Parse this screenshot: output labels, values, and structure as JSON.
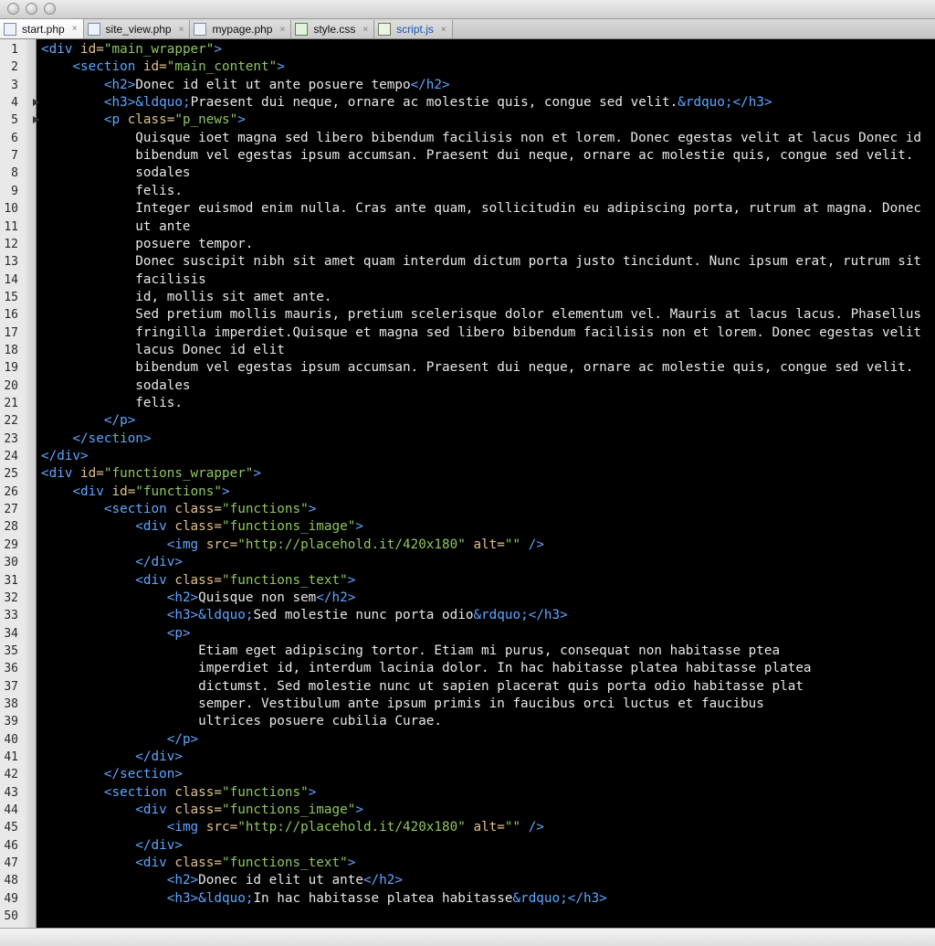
{
  "tabs": [
    {
      "label": "start.php",
      "type": "php",
      "active": true,
      "close": "×"
    },
    {
      "label": "site_view.php",
      "type": "php",
      "active": false,
      "close": "×"
    },
    {
      "label": "mypage.php",
      "type": "php",
      "active": false,
      "close": "×"
    },
    {
      "label": "style.css",
      "type": "css",
      "active": false,
      "close": "×"
    },
    {
      "label": "script.js",
      "type": "js",
      "active": false,
      "close": "×"
    }
  ],
  "colors": {
    "background": "#000000",
    "tag": "#5ea6ff",
    "attribute": "#e2c08d",
    "string": "#8ec760",
    "text": "#e8e8e8",
    "entity": "#5ea6ff"
  },
  "code": [
    {
      "n": "1",
      "fold": false,
      "segs": [
        [
          "t",
          "<div "
        ],
        [
          "a",
          "id="
        ],
        [
          "s",
          "\"main_wrapper\""
        ],
        [
          "t",
          ">"
        ]
      ]
    },
    {
      "n": "2",
      "fold": false,
      "segs": [
        [
          "x",
          "    "
        ],
        [
          "t",
          "<section "
        ],
        [
          "a",
          "id="
        ],
        [
          "s",
          "\"main_content\""
        ],
        [
          "t",
          ">"
        ]
      ]
    },
    {
      "n": "3",
      "fold": false,
      "segs": [
        [
          "x",
          "        "
        ],
        [
          "t",
          "<h2>"
        ],
        [
          "x",
          "Donec id elit ut ante posuere tempo"
        ],
        [
          "t",
          "</h2>"
        ]
      ]
    },
    {
      "n": "4",
      "fold": true,
      "segs": [
        [
          "x",
          "        "
        ],
        [
          "t",
          "<h3>"
        ],
        [
          "e",
          "&ldquo;"
        ],
        [
          "x",
          "Praesent dui neque, ornare ac molestie quis, congue sed velit."
        ],
        [
          "e",
          "&rdquo;"
        ],
        [
          "t",
          "</h3>"
        ]
      ]
    },
    {
      "n": "5",
      "fold": true,
      "segs": [
        [
          "x",
          "        "
        ],
        [
          "t",
          "<p "
        ],
        [
          "a",
          "class="
        ],
        [
          "s",
          "\"p_news\""
        ],
        [
          "t",
          ">"
        ]
      ]
    },
    {
      "n": "6",
      "fold": false,
      "segs": [
        [
          "x",
          "            Quisque ioet magna sed libero bibendum facilisis non et lorem. Donec egestas velit at lacus Donec id"
        ]
      ]
    },
    {
      "n": "7",
      "fold": false,
      "segs": [
        [
          "x",
          "            bibendum vel egestas ipsum accumsan. Praesent dui neque, ornare ac molestie quis, congue sed velit. "
        ]
      ]
    },
    {
      "n": "8",
      "fold": false,
      "segs": [
        [
          "x",
          "            sodales"
        ]
      ]
    },
    {
      "n": "9",
      "fold": false,
      "segs": [
        [
          "x",
          "            felis."
        ]
      ]
    },
    {
      "n": "10",
      "fold": false,
      "segs": [
        [
          "x",
          "            Integer euismod enim nulla. Cras ante quam, sollicitudin eu adipiscing porta, rutrum at magna. Donec"
        ]
      ]
    },
    {
      "n": "11",
      "fold": false,
      "segs": [
        [
          "x",
          "            ut ante"
        ]
      ]
    },
    {
      "n": "12",
      "fold": false,
      "segs": [
        [
          "x",
          "            posuere tempor."
        ]
      ]
    },
    {
      "n": "13",
      "fold": false,
      "segs": [
        [
          "x",
          "            Donec suscipit nibh sit amet quam interdum dictum porta justo tincidunt. Nunc ipsum erat, rutrum sit"
        ]
      ]
    },
    {
      "n": "14",
      "fold": false,
      "segs": [
        [
          "x",
          "            facilisis"
        ]
      ]
    },
    {
      "n": "15",
      "fold": false,
      "segs": [
        [
          "x",
          "            id, mollis sit amet ante."
        ]
      ]
    },
    {
      "n": "16",
      "fold": false,
      "segs": [
        [
          "x",
          "            Sed pretium mollis mauris, pretium scelerisque dolor elementum vel. Mauris at lacus lacus. Phasellus"
        ]
      ]
    },
    {
      "n": "17",
      "fold": false,
      "segs": [
        [
          "x",
          "            fringilla imperdiet.Quisque et magna sed libero bibendum facilisis non et lorem. Donec egestas velit"
        ]
      ]
    },
    {
      "n": "18",
      "fold": false,
      "segs": [
        [
          "x",
          "            lacus Donec id elit"
        ]
      ]
    },
    {
      "n": "19",
      "fold": false,
      "segs": [
        [
          "x",
          "            bibendum vel egestas ipsum accumsan. Praesent dui neque, ornare ac molestie quis, congue sed velit. "
        ]
      ]
    },
    {
      "n": "20",
      "fold": false,
      "segs": [
        [
          "x",
          "            sodales"
        ]
      ]
    },
    {
      "n": "21",
      "fold": false,
      "segs": [
        [
          "x",
          "            felis."
        ]
      ]
    },
    {
      "n": "22",
      "fold": false,
      "segs": [
        [
          "x",
          "        "
        ],
        [
          "t",
          "</p>"
        ]
      ]
    },
    {
      "n": "23",
      "fold": false,
      "segs": [
        [
          "x",
          "    "
        ],
        [
          "t",
          "</section>"
        ]
      ]
    },
    {
      "n": "24",
      "fold": false,
      "segs": [
        [
          "t",
          "</div>"
        ]
      ]
    },
    {
      "n": "25",
      "fold": false,
      "segs": [
        [
          "t",
          "<div "
        ],
        [
          "a",
          "id="
        ],
        [
          "s",
          "\"functions_wrapper\""
        ],
        [
          "t",
          ">"
        ]
      ]
    },
    {
      "n": "26",
      "fold": false,
      "segs": [
        [
          "x",
          "    "
        ],
        [
          "t",
          "<div "
        ],
        [
          "a",
          "id="
        ],
        [
          "s",
          "\"functions\""
        ],
        [
          "t",
          ">"
        ]
      ]
    },
    {
      "n": "27",
      "fold": false,
      "segs": [
        [
          "x",
          "        "
        ],
        [
          "t",
          "<section "
        ],
        [
          "a",
          "class="
        ],
        [
          "s",
          "\"functions\""
        ],
        [
          "t",
          ">"
        ]
      ]
    },
    {
      "n": "28",
      "fold": false,
      "segs": [
        [
          "x",
          "            "
        ],
        [
          "t",
          "<div "
        ],
        [
          "a",
          "class="
        ],
        [
          "s",
          "\"functions_image\""
        ],
        [
          "t",
          ">"
        ]
      ]
    },
    {
      "n": "29",
      "fold": false,
      "segs": [
        [
          "x",
          "                "
        ],
        [
          "t",
          "<img "
        ],
        [
          "a",
          "src="
        ],
        [
          "s",
          "\"http://placehold.it/420x180\""
        ],
        [
          "x",
          " "
        ],
        [
          "a",
          "alt="
        ],
        [
          "s",
          "\"\""
        ],
        [
          "x",
          " "
        ],
        [
          "t",
          "/>"
        ]
      ]
    },
    {
      "n": "30",
      "fold": false,
      "segs": [
        [
          "x",
          "            "
        ],
        [
          "t",
          "</div>"
        ]
      ]
    },
    {
      "n": "31",
      "fold": false,
      "segs": [
        [
          "x",
          "            "
        ],
        [
          "t",
          "<div "
        ],
        [
          "a",
          "class="
        ],
        [
          "s",
          "\"functions_text\""
        ],
        [
          "t",
          ">"
        ]
      ]
    },
    {
      "n": "32",
      "fold": false,
      "segs": [
        [
          "x",
          "                "
        ],
        [
          "t",
          "<h2>"
        ],
        [
          "x",
          "Quisque non sem"
        ],
        [
          "t",
          "</h2>"
        ]
      ]
    },
    {
      "n": "33",
      "fold": false,
      "segs": [
        [
          "x",
          "                "
        ],
        [
          "t",
          "<h3>"
        ],
        [
          "e",
          "&ldquo;"
        ],
        [
          "x",
          "Sed molestie nunc porta odio"
        ],
        [
          "e",
          "&rdquo;"
        ],
        [
          "t",
          "</h3>"
        ]
      ]
    },
    {
      "n": "34",
      "fold": false,
      "segs": [
        [
          "x",
          "                "
        ],
        [
          "t",
          "<p>"
        ]
      ]
    },
    {
      "n": "35",
      "fold": false,
      "segs": [
        [
          "x",
          "                    Etiam eget adipiscing tortor. Etiam mi purus, consequat non habitasse ptea"
        ]
      ]
    },
    {
      "n": "36",
      "fold": false,
      "segs": [
        [
          "x",
          "                    imperdiet id, interdum lacinia dolor. In hac habitasse platea habitasse platea"
        ]
      ]
    },
    {
      "n": "37",
      "fold": false,
      "segs": [
        [
          "x",
          "                    dictumst. Sed molestie nunc ut sapien placerat quis porta odio habitasse plat"
        ]
      ]
    },
    {
      "n": "38",
      "fold": false,
      "segs": [
        [
          "x",
          "                    semper. Vestibulum ante ipsum primis in faucibus orci luctus et faucibus"
        ]
      ]
    },
    {
      "n": "39",
      "fold": false,
      "segs": [
        [
          "x",
          "                    ultrices posuere cubilia Curae."
        ]
      ]
    },
    {
      "n": "40",
      "fold": false,
      "segs": [
        [
          "x",
          "                "
        ],
        [
          "t",
          "</p>"
        ]
      ]
    },
    {
      "n": "41",
      "fold": false,
      "segs": [
        [
          "x",
          "            "
        ],
        [
          "t",
          "</div>"
        ]
      ]
    },
    {
      "n": "42",
      "fold": false,
      "segs": [
        [
          "x",
          "        "
        ],
        [
          "t",
          "</section>"
        ]
      ]
    },
    {
      "n": "43",
      "fold": false,
      "segs": [
        [
          "x",
          "        "
        ],
        [
          "t",
          "<section "
        ],
        [
          "a",
          "class="
        ],
        [
          "s",
          "\"functions\""
        ],
        [
          "t",
          ">"
        ]
      ]
    },
    {
      "n": "44",
      "fold": false,
      "segs": [
        [
          "x",
          "            "
        ],
        [
          "t",
          "<div "
        ],
        [
          "a",
          "class="
        ],
        [
          "s",
          "\"functions_image\""
        ],
        [
          "t",
          ">"
        ]
      ]
    },
    {
      "n": "45",
      "fold": false,
      "segs": [
        [
          "x",
          "                "
        ],
        [
          "t",
          "<img "
        ],
        [
          "a",
          "src="
        ],
        [
          "s",
          "\"http://placehold.it/420x180\""
        ],
        [
          "x",
          " "
        ],
        [
          "a",
          "alt="
        ],
        [
          "s",
          "\"\""
        ],
        [
          "x",
          " "
        ],
        [
          "t",
          "/>"
        ]
      ]
    },
    {
      "n": "46",
      "fold": false,
      "segs": [
        [
          "x",
          "            "
        ],
        [
          "t",
          "</div>"
        ]
      ]
    },
    {
      "n": "47",
      "fold": false,
      "segs": [
        [
          "x",
          "            "
        ],
        [
          "t",
          "<div "
        ],
        [
          "a",
          "class="
        ],
        [
          "s",
          "\"functions_text\""
        ],
        [
          "t",
          ">"
        ]
      ]
    },
    {
      "n": "48",
      "fold": false,
      "segs": [
        [
          "x",
          "                "
        ],
        [
          "t",
          "<h2>"
        ],
        [
          "x",
          "Donec id elit ut ante"
        ],
        [
          "t",
          "</h2>"
        ]
      ]
    },
    {
      "n": "49",
      "fold": false,
      "segs": [
        [
          "x",
          "                "
        ],
        [
          "t",
          "<h3>"
        ],
        [
          "e",
          "&ldquo;"
        ],
        [
          "x",
          "In hac habitasse platea habitasse"
        ],
        [
          "e",
          "&rdquo;"
        ],
        [
          "t",
          "</h3>"
        ]
      ]
    },
    {
      "n": "50",
      "fold": false,
      "segs": []
    }
  ]
}
